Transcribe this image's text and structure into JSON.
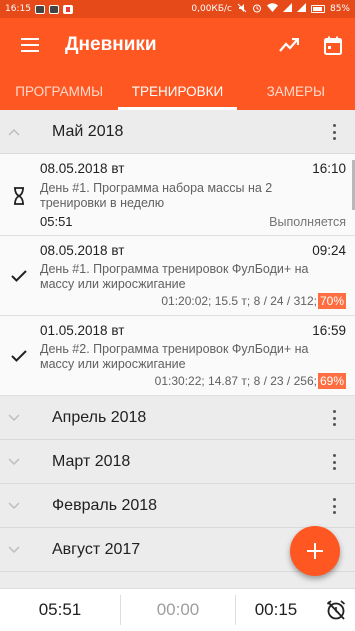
{
  "status_bar": {
    "time": "16:15",
    "network_speed": "0,00КБ/с",
    "battery": "85%",
    "icons": [
      "notification-icon",
      "app-icon",
      "app-icon",
      "mute-icon",
      "alarm-icon",
      "wifi-icon",
      "signal-icon",
      "signal-icon",
      "battery-icon"
    ]
  },
  "app_bar": {
    "title": "Дневники",
    "icons": [
      "menu-icon",
      "trend-chart-icon",
      "calendar-icon"
    ],
    "accent_color": "#ff5722"
  },
  "tabs": [
    {
      "label": "ПРОГРАММЫ",
      "active": false
    },
    {
      "label": "ТРЕНИРОВКИ",
      "active": true
    },
    {
      "label": "ЗАМЕРЫ",
      "active": false
    }
  ],
  "months": [
    {
      "title": "Май 2018",
      "expanded": true,
      "entries": [
        {
          "date": "08.05.2018 вт",
          "time": "16:10",
          "description": "День #1. Программа набора массы на 2 тренировки в неделю",
          "duration": "05:51",
          "status": "Выполняется",
          "icon": "hourglass-icon"
        },
        {
          "date": "08.05.2018 вт",
          "time": "09:24",
          "description": "День #1. Программа тренировок ФулБоди+ на массу или жиросжигание",
          "stats": "01:20:02; 15.5 т; 8 / 24 / 312;",
          "percent": "70%",
          "icon": "check-icon"
        },
        {
          "date": "01.05.2018 вт",
          "time": "16:59",
          "description": "День #2. Программа тренировок ФулБоди+ на массу или жиросжигание",
          "stats": "01:30:22; 14.87 т; 8 / 23 / 256;",
          "percent": "69%",
          "icon": "check-icon"
        }
      ]
    },
    {
      "title": "Апрель 2018",
      "expanded": false
    },
    {
      "title": "Март 2018",
      "expanded": false
    },
    {
      "title": "Февраль 2018",
      "expanded": false
    },
    {
      "title": "Август 2017",
      "expanded": false
    }
  ],
  "fab": {
    "icon": "plus-icon"
  },
  "timer_bar": {
    "elapsed": "05:51",
    "rest": "00:00",
    "countdown": "00:15",
    "icon": "alarm-off-icon"
  }
}
